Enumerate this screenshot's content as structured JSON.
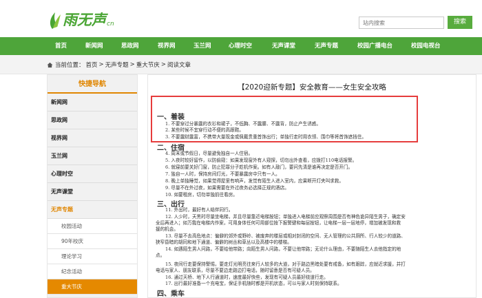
{
  "header": {
    "logo_text": "雨无声",
    "logo_suffix": "cn",
    "search_placeholder": "站内搜索",
    "search_button": "搜索"
  },
  "nav": {
    "items": [
      "首页",
      "新闻网",
      "思政网",
      "视界网",
      "玉兰网",
      "心理时空",
      "无声课堂",
      "无声专题",
      "校园广播电台",
      "校园电视台"
    ]
  },
  "breadcrumb": {
    "prefix": "当前位置：",
    "items": [
      "首页",
      ">",
      "无声专题",
      ">",
      "重大节庆",
      ">",
      "阅读文章"
    ]
  },
  "sidebar": {
    "title": "快捷导航",
    "items": [
      "新闻网",
      "思政网",
      "视界网",
      "玉兰网",
      "心理时空",
      "无声课堂",
      "无声专题"
    ],
    "subitems": [
      "校园活动",
      "90年校庆",
      "理论学习",
      "纪念活动",
      "重大节庆"
    ]
  },
  "article": {
    "title": "【2020迎新专题】安全教育——女生安全攻略",
    "sections": {
      "s1": "一、着装",
      "s2": "二、住宿",
      "s3": "三、出行",
      "s4": "四、乘车"
    },
    "lines": {
      "l1": "1. 不要穿过分暴露的衣衫和裙子，不低胸、不露腰、不露背，防止产生诱惑。",
      "l2": "2. 某些时候不宜穿行动不便的高跟鞋。",
      "l3": "3. 不要露财露富，不携带大量现金或佩戴贵重首饰出行；单独行走时用衣领、围巾等将首饰遮挡住。",
      "l4": "4. 周末或节假日，尽量避免独自一人住宿。",
      "l5": "5. 入夜时较好留作，以防偷窥：如果发现窗外有人窥探，切勿出外查看，应拨打110电话报警。",
      "l6": "6. 就寝前要关好门窗，防止犯罪分子趁机作案。如有人敲门，要问先清是谁再决定是否开门。",
      "l7": "7. 独自一人时，保持房间灯光，不要暴露房中只有一人。",
      "l8": "8. 晚上单独睡觉，如果觉得屋里有响声，发觉有陌生人进入室内，应果断开灯夹叫求救。",
      "l9": "9. 尽量不在外过夜，如果需要在外过夜务必选择正规的酒店。",
      "l10": "10. 如要租房，切勿单独前往看房。",
      "l11": "11. 外出时，最好有人结伴同行。",
      "l12a": "12. 人少时，天黑时尽量坐电梯，并且尽量靠近电梯按钮；单独进入电梯前应观察周围是否有神色诡异陌生男子，确定安",
      "l12b": "全后再进入；如万我在电梯内作案，可用身体任何可用部位按下报警键和每层按钮，让电梯一层一层地停，增加被发现和救",
      "l12c": "援的机会。",
      "l13a": "13. 尽量不去高危地点：偏僻的郊外或野岭、被废弃的楼层或相对封闭的空间、无人管理的公共厕所、行人较少的道路、",
      "l13b": "狭窄昏暗的胡同和地下通道、偏僻的树丛和草丛以及高楼中的楼梯。",
      "l14a": "14. 如遇陌生男人问路，不要给他带路；向陌生男人问路，不要让他带路；无论什么理由，不要随陌生人去他指定的地",
      "l14b": "点。",
      "l15a": "15. 夜间行走要保持警惕，要走灯光明亮往来行人较多的大道，对于路边黑暗处要有戒备，如有跟踪，应就近求援，并打",
      "l15b": "电话与家人、朋友联系，尽量不要边走路边打电话，随时留意是否有可疑人员。",
      "l16": "16. 通过天桥、地下人行通道时，速度最好快些，发现有可疑人员最好绕道行走。",
      "l17": "17. 出行最好准备一个充电宝，保证手机随时都是开机状态，可以与家人时刻保持联系。"
    }
  },
  "colors": {
    "brand_green": "#4ea53a",
    "accent_orange": "#e58900",
    "highlight_red": "#e63c3c"
  }
}
